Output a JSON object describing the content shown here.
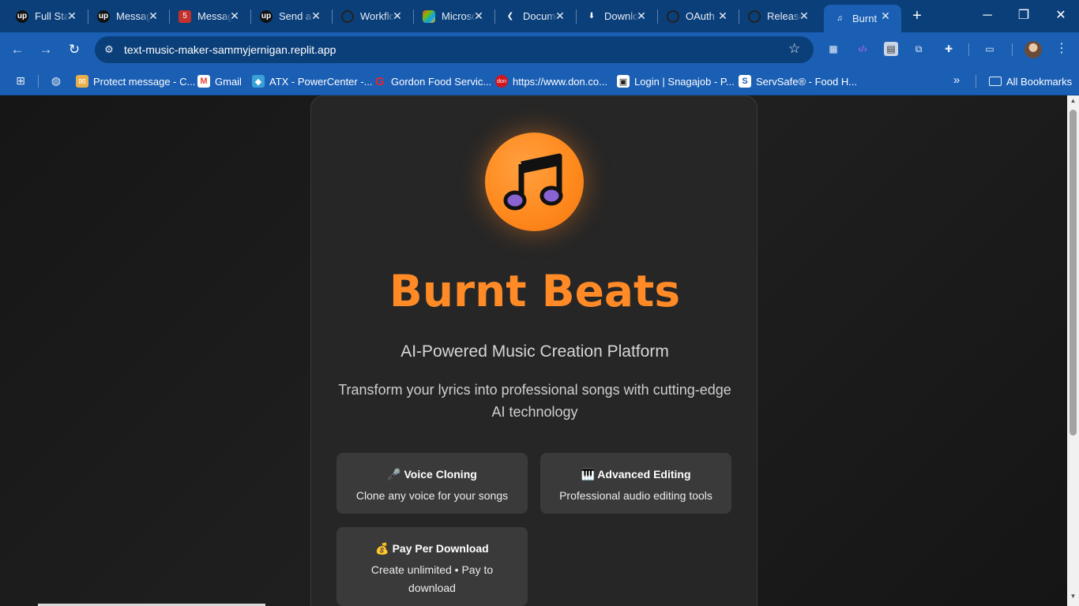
{
  "browser": {
    "tabs": [
      {
        "title": "Full Stack",
        "icon": "upwork-icon",
        "active": false
      },
      {
        "title": "Messages",
        "icon": "upwork-icon",
        "active": false
      },
      {
        "title": "Messages",
        "icon": "red-badge-icon",
        "badge": "5",
        "active": false
      },
      {
        "title": "Send a",
        "icon": "upwork-icon",
        "active": false
      },
      {
        "title": "Workflow",
        "icon": "github-icon",
        "active": false
      },
      {
        "title": "Microsoft",
        "icon": "microsoft-icon",
        "active": false
      },
      {
        "title": "Documentation",
        "icon": "vscode-icon",
        "active": false
      },
      {
        "title": "Downloads",
        "icon": "download-icon",
        "active": false
      },
      {
        "title": "OAuth",
        "icon": "github-icon",
        "active": false
      },
      {
        "title": "Releases",
        "icon": "github-icon",
        "active": false
      },
      {
        "title": "Burnt",
        "icon": "music-note-icon",
        "active": true
      }
    ],
    "url": "text-music-maker-sammyjernigan.replit.app",
    "bookmarks": [
      {
        "label": "Protect message - C...",
        "icon": "mail-shield-icon"
      },
      {
        "label": "Gmail",
        "icon": "gmail-icon"
      },
      {
        "label": "ATX - PowerCenter -...",
        "icon": "powercenter-icon"
      },
      {
        "label": "Gordon Food Servic...",
        "icon": "gordon-food-icon"
      },
      {
        "label": "https://www.don.co...",
        "icon": "don-icon"
      },
      {
        "label": "Login | Snagajob - P...",
        "icon": "snagajob-icon"
      },
      {
        "label": "ServSafe® - Food H...",
        "icon": "servsafe-icon"
      }
    ],
    "all_bookmarks_label": "All Bookmarks"
  },
  "page": {
    "title": "Burnt Beats",
    "subtitle": "AI-Powered Music Creation Platform",
    "description": "Transform your lyrics into professional songs with cutting-edge AI technology",
    "features": [
      {
        "icon": "🎤",
        "title": "Voice Cloning",
        "body": "Clone any voice for your songs"
      },
      {
        "icon": "🎹",
        "title": "Advanced Editing",
        "body": "Professional audio editing tools"
      },
      {
        "icon": "💰",
        "title": "Pay Per Download",
        "body": "Create unlimited • Pay to download"
      }
    ]
  },
  "colors": {
    "accent": "#ff8a26",
    "tab_strip": "#0b3f7a",
    "toolbar": "#1a5fb4",
    "card": "#262626",
    "feature_tile": "#3a3a3a",
    "logo_note": "#8a63d2"
  }
}
